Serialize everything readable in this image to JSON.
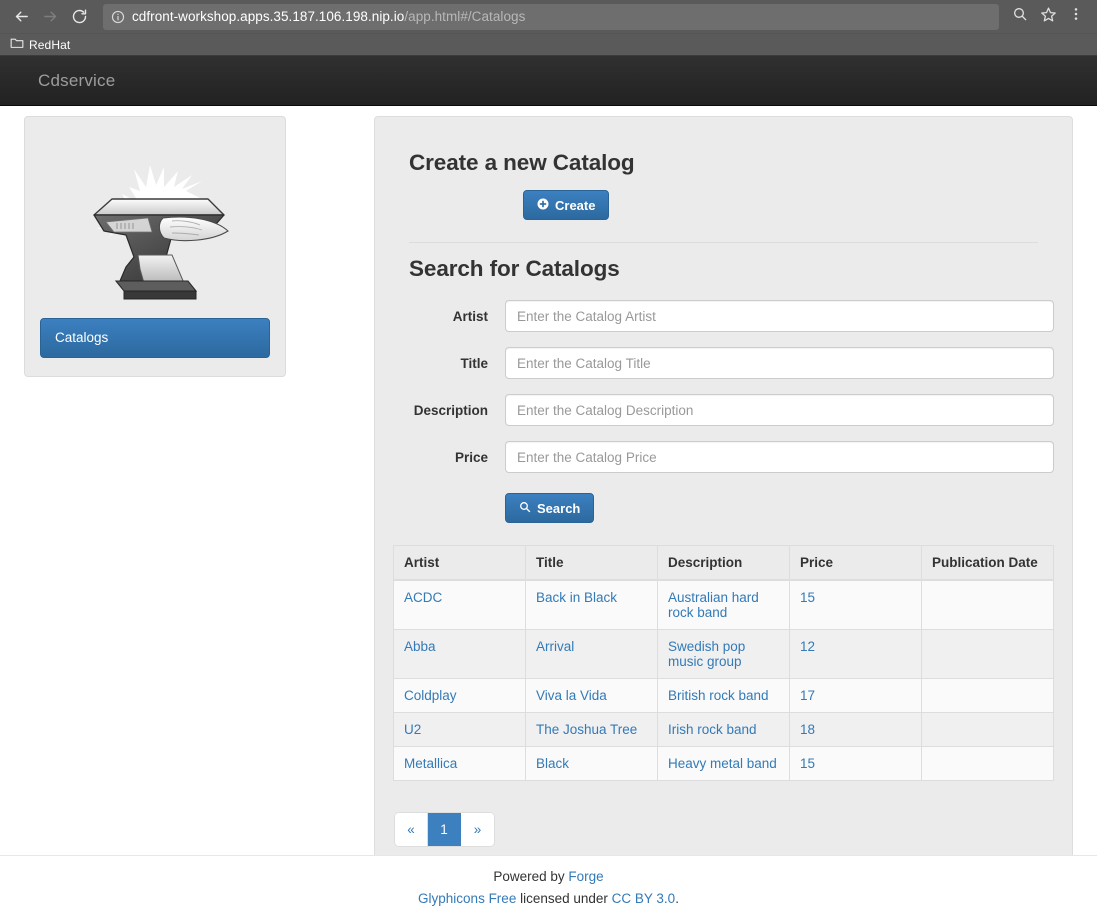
{
  "browser": {
    "back_icon": "back-arrow-icon",
    "forward_icon": "forward-arrow-icon",
    "reload_icon": "reload-icon",
    "info_icon": "page-info-icon",
    "url_host": "cdfront-workshop.apps.35.187.106.198.nip.io",
    "url_path": "/app.html#/Catalogs",
    "search_icon": "search-icon",
    "bookmark_star_icon": "star-icon",
    "menu_icon": "three-dot-menu-icon",
    "bookmarks": [
      {
        "label": "RedHat",
        "icon": "folder-icon"
      }
    ]
  },
  "navbar": {
    "brand": "Cdservice"
  },
  "sidebar": {
    "logo_alt": "forge-anvil-logo",
    "items": [
      {
        "label": "Catalogs",
        "active": true
      }
    ]
  },
  "main": {
    "create_section": {
      "title": "Create a new Catalog",
      "create_label": "Create",
      "create_icon": "plus-circle-icon"
    },
    "search_section": {
      "title": "Search for Catalogs",
      "fields": [
        {
          "label": "Artist",
          "placeholder": "Enter the Catalog Artist",
          "value": ""
        },
        {
          "label": "Title",
          "placeholder": "Enter the Catalog Title",
          "value": ""
        },
        {
          "label": "Description",
          "placeholder": "Enter the Catalog Description",
          "value": ""
        },
        {
          "label": "Price",
          "placeholder": "Enter the Catalog Price",
          "value": ""
        }
      ],
      "search_label": "Search",
      "search_icon": "magnifier-icon"
    },
    "table": {
      "columns": [
        "Artist",
        "Title",
        "Description",
        "Price",
        "Publication Date"
      ],
      "rows": [
        {
          "artist": "ACDC",
          "title": "Back in Black",
          "description": "Australian hard rock band",
          "price": "15",
          "publication_date": ""
        },
        {
          "artist": "Abba",
          "title": "Arrival",
          "description": "Swedish pop music group",
          "price": "12",
          "publication_date": ""
        },
        {
          "artist": "Coldplay",
          "title": "Viva la Vida",
          "description": "British rock band",
          "price": "17",
          "publication_date": ""
        },
        {
          "artist": "U2",
          "title": "The Joshua Tree",
          "description": "Irish rock band",
          "price": "18",
          "publication_date": ""
        },
        {
          "artist": "Metallica",
          "title": "Black",
          "description": "Heavy metal band",
          "price": "15",
          "publication_date": ""
        }
      ]
    },
    "pagination": {
      "prev_label": "«",
      "pages": [
        "1"
      ],
      "next_label": "»",
      "current_page": "1"
    }
  },
  "footer": {
    "line1_prefix": "Powered by ",
    "line1_link": "Forge",
    "line2_link1": "Glyphicons Free",
    "line2_middle": " licensed under ",
    "line2_link2": "CC BY 3.0",
    "line2_suffix": "."
  },
  "colors": {
    "brand_blue": "#3c80c0",
    "link_blue": "#337ab7",
    "navbar_dark": "#222222",
    "panel_gray": "#ebebeb",
    "chrome_gray": "#5a5a5a"
  }
}
